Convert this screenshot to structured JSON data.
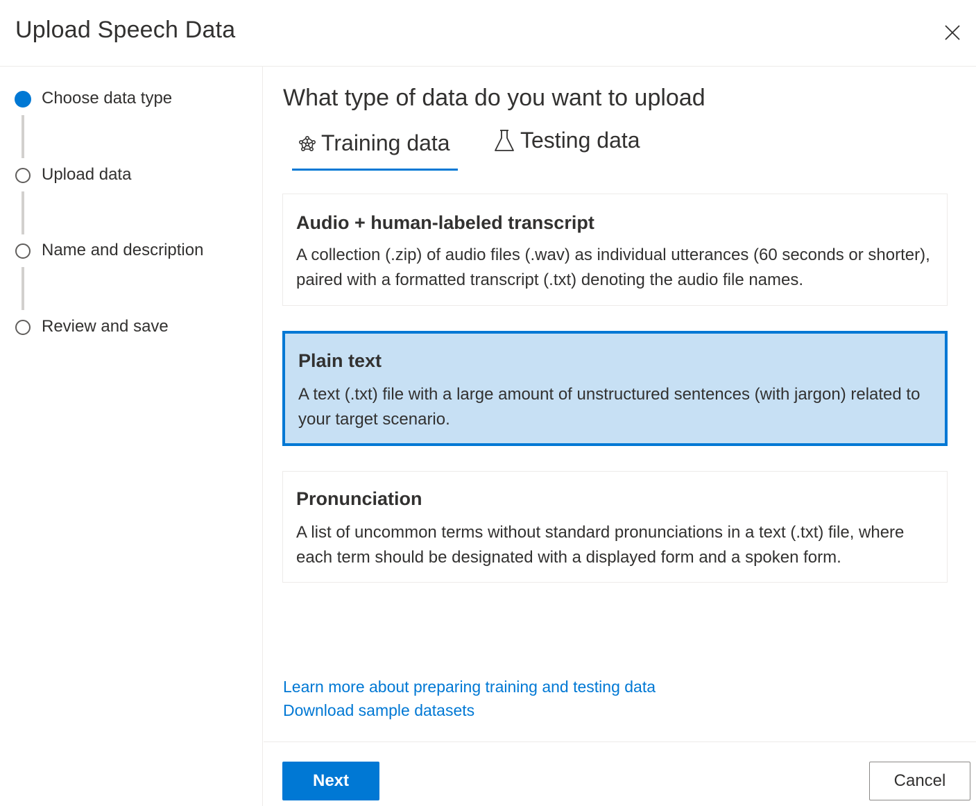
{
  "dialog": {
    "title": "Upload Speech Data",
    "close_icon": "close-icon"
  },
  "steps": [
    {
      "label": "Choose data type",
      "state": "active"
    },
    {
      "label": "Upload data",
      "state": "pending"
    },
    {
      "label": "Name and description",
      "state": "pending"
    },
    {
      "label": "Review and save",
      "state": "pending"
    }
  ],
  "main": {
    "heading": "What type of data do you want to upload",
    "tabs": [
      {
        "label": "Training data",
        "icon": "brain-icon",
        "selected": true
      },
      {
        "label": "Testing data",
        "icon": "flask-icon",
        "selected": false
      }
    ],
    "options": [
      {
        "title": "Audio + human-labeled transcript",
        "description": "A collection (.zip) of audio files (.wav) as individual utterances (60 seconds or shorter), paired with a formatted transcript (.txt) denoting the audio file names.",
        "selected": false
      },
      {
        "title": "Plain text",
        "description": "A text (.txt) file with a large amount of unstructured sentences (with jargon) related to your target scenario.",
        "selected": true
      },
      {
        "title": "Pronunciation",
        "description": "A list of uncommon terms without standard pronunciations in a text (.txt) file, where each term should be designated with a displayed form and a spoken form.",
        "selected": false
      }
    ],
    "links": [
      "Learn more about preparing training and testing data",
      "Download sample datasets"
    ]
  },
  "footer": {
    "next_label": "Next",
    "cancel_label": "Cancel"
  },
  "colors": {
    "accent": "#0078d4",
    "selected_bg": "#c7e0f4",
    "text": "#323130",
    "divider": "#edebe9"
  }
}
